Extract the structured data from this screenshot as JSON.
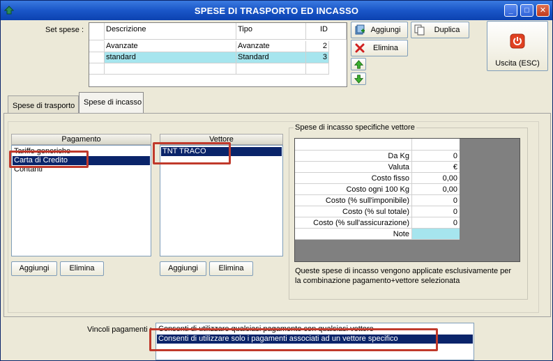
{
  "window": {
    "title": "SPESE DI TRASPORTO ED INCASSO",
    "controls": [
      "_",
      "□",
      "✕"
    ]
  },
  "set_spese": {
    "label": "Set spese :",
    "columns": [
      "Descrizione",
      "Tipo",
      "ID"
    ],
    "rows": [
      {
        "descrizione": "Avanzate",
        "tipo": "Avanzate",
        "id": "2"
      },
      {
        "descrizione": "standard",
        "tipo": "Standard",
        "id": "3"
      }
    ]
  },
  "buttons": {
    "aggiungi": "Aggiungi",
    "elimina": "Elimina",
    "duplica": "Duplica",
    "uscita": "Uscita (ESC)"
  },
  "tabs": [
    "Spese di trasporto",
    "Spese di incasso"
  ],
  "pagamento": {
    "header": "Pagamento",
    "items": [
      "Tariffe generiche",
      "Carta di Credito",
      "Contanti"
    ],
    "add": "Aggiungi",
    "del": "Elimina"
  },
  "vettore": {
    "header": "Vettore",
    "items": [
      "TNT TRACO"
    ],
    "add": "Aggiungi",
    "del": "Elimina"
  },
  "spese_incasso": {
    "group_title": "Spese di incasso specifiche vettore",
    "fields": [
      {
        "label": "Da Kg",
        "value": "0"
      },
      {
        "label": "Valuta",
        "value": "€"
      },
      {
        "label": "Costo fisso",
        "value": "0,00"
      },
      {
        "label": "Costo ogni 100 Kg",
        "value": "0,00"
      },
      {
        "label": "Costo (% sull'imponibile)",
        "value": "0"
      },
      {
        "label": "Costo (% sul totale)",
        "value": "0"
      },
      {
        "label": "Costo (% sull'assicurazione)",
        "value": "0"
      },
      {
        "label": "Note",
        "value": ""
      }
    ],
    "info_line1": "Queste spese di incasso vengono applicate esclusivamente per",
    "info_line2": "la combinazione pagamento+vettore selezionata"
  },
  "vincoli": {
    "label": "Vincoli pagamenti :",
    "options": [
      "Consenti di utilizzare qualsiasi pagamento con qualsiasi vettore",
      "Consenti di utilizzare solo i pagamenti associati ad un vettore specifico"
    ]
  },
  "colors": {
    "title_blue": "#1a56c8",
    "selection": "#0a246a",
    "row_highlight": "#a6e5ee",
    "annotation_red": "#c0392b"
  }
}
